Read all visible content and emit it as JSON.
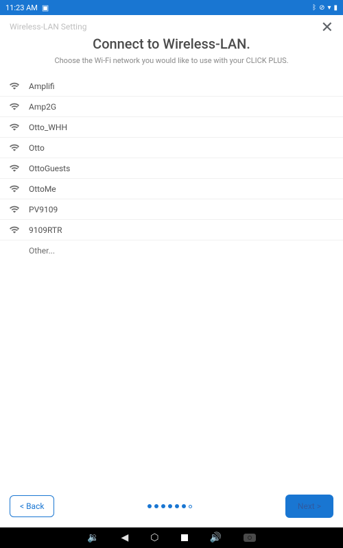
{
  "statusbar": {
    "time": "11:23 AM"
  },
  "header": {
    "label": "Wireless-LAN Setting",
    "close": "✕"
  },
  "title": "Connect to Wireless-LAN.",
  "subtitle": "Choose the Wi-Fi network you would like to use with your CLICK PLUS.",
  "networks": [
    {
      "name": "Amplifi"
    },
    {
      "name": "Amp2G"
    },
    {
      "name": "Otto_WHH"
    },
    {
      "name": "Otto"
    },
    {
      "name": "OttoGuests"
    },
    {
      "name": "OttoMe"
    },
    {
      "name": "PV9109"
    },
    {
      "name": "9109RTR"
    }
  ],
  "other_label": "Other...",
  "footer": {
    "back": "< Back",
    "next": "Next >"
  },
  "progress": {
    "total": 7,
    "current": 6
  }
}
